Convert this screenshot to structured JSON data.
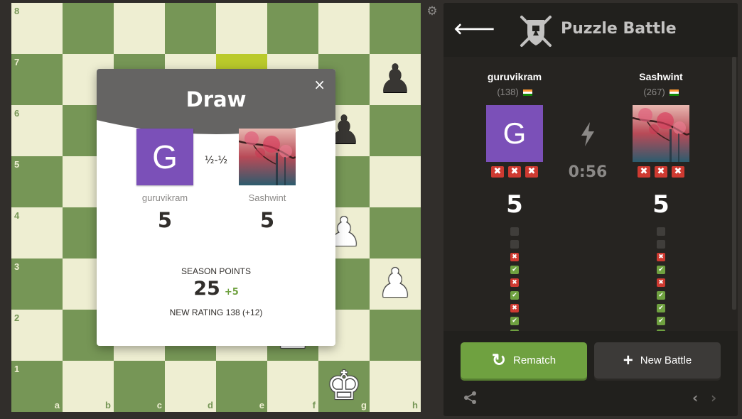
{
  "board": {
    "rank_labels": [
      "8",
      "7",
      "6",
      "5",
      "4",
      "3",
      "2",
      "1"
    ],
    "file_labels": [
      "a",
      "b",
      "c",
      "d",
      "e",
      "f",
      "g",
      "h"
    ],
    "highlighted_square": "e7",
    "pieces": [
      {
        "square": "h7",
        "glyph": "♟",
        "color": "black",
        "name": "black-pawn-h7"
      },
      {
        "square": "g6",
        "glyph": "♟",
        "color": "black",
        "name": "black-pawn-g6"
      },
      {
        "square": "g4",
        "glyph": "♟",
        "color": "white",
        "name": "white-pawn-g4"
      },
      {
        "square": "h3",
        "glyph": "♟",
        "color": "white",
        "name": "white-pawn-h3"
      },
      {
        "square": "f2",
        "glyph": "♟",
        "color": "white",
        "name": "white-pawn-f2"
      },
      {
        "square": "g1",
        "glyph": "♚",
        "color": "white",
        "name": "white-king-g1"
      }
    ]
  },
  "settings_icon": "gear-icon",
  "modal": {
    "title": "Draw",
    "close": "×",
    "score_text": "½-½",
    "header_color": "#656463",
    "player1": {
      "name": "guruvikram",
      "initial": "G",
      "score": "5"
    },
    "player2": {
      "name": "Sashwint",
      "score": "5"
    },
    "season_label": "SEASON POINTS",
    "season_points": "25",
    "season_delta": "+5",
    "new_rating": "NEW RATING 138 (+12)"
  },
  "panel": {
    "title": "Puzzle Battle",
    "timer": "0:56",
    "player1": {
      "name": "guruvikram",
      "rating": "(138)",
      "initial": "G",
      "score": "5",
      "strikes": [
        "✖",
        "✖",
        "✖"
      ],
      "results": [
        "empty",
        "empty",
        "bad",
        "good",
        "bad",
        "good",
        "bad",
        "good",
        "good"
      ]
    },
    "player2": {
      "name": "Sashwint",
      "rating": "(267)",
      "score": "5",
      "strikes": [
        "✖",
        "✖",
        "✖"
      ],
      "results": [
        "empty",
        "empty",
        "bad",
        "good",
        "bad",
        "good",
        "good",
        "good",
        "good"
      ]
    },
    "rematch_label": "Rematch",
    "new_battle_label": "New Battle"
  },
  "colors": {
    "light_square": "#eeeed2",
    "dark_square": "#769656",
    "highlight": "#baca2b",
    "avatar_purple": "#7b50b8",
    "accent_green": "#6fa140",
    "strike_red": "#ce3a31"
  }
}
